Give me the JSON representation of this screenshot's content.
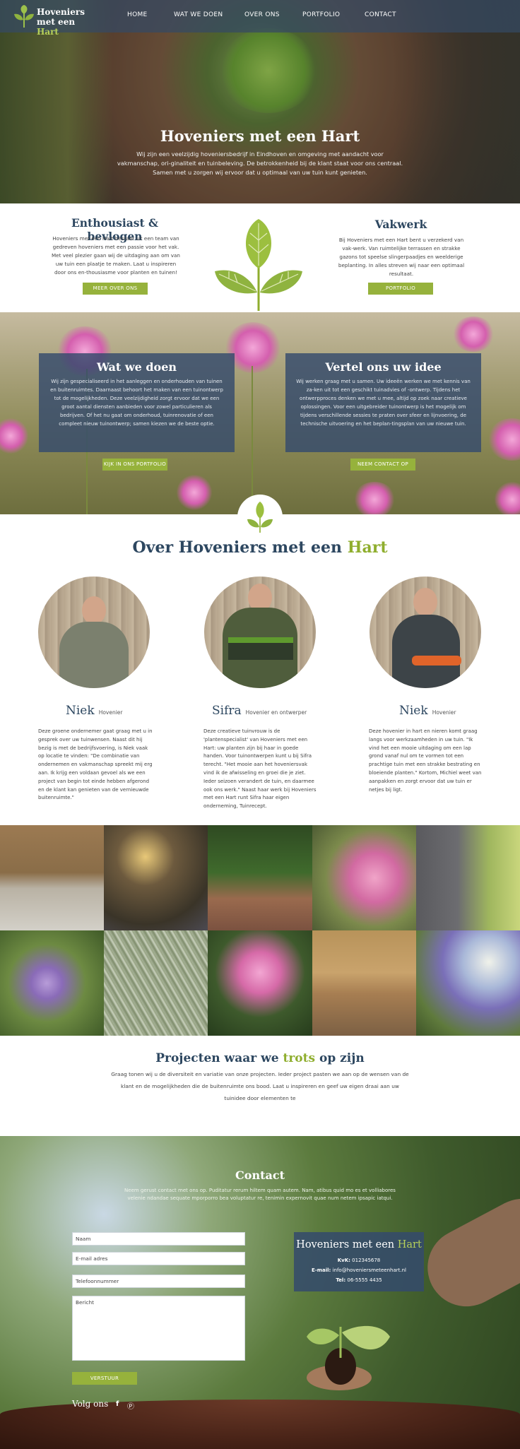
{
  "brand": {
    "line1": "Hoveniers",
    "line2a": "met een",
    "line2b": "Hart"
  },
  "nav": [
    "HOME",
    "WAT WE DOEN",
    "OVER ONS",
    "PORTFOLIO",
    "CONTACT"
  ],
  "hero": {
    "title": "Hoveniers met een Hart",
    "subtitle": "Wij zijn een veelzijdig hoveniersbedrijf in Eindhoven en omgeving met aandacht voor vakmanschap, ori-ginaliteit en tuinbeleving. De betrokkenheid bij de klant staat voor ons centraal. Samen met u zorgen wij ervoor dat u optimaal van uw tuin kunt genieten."
  },
  "intro": {
    "left": {
      "title": "Enthousiast & bevlogen",
      "text": "Hoveniers met een Hart bestaat uit een team van gedreven hoveniers met een passie voor het vak. Met veel plezier gaan wij de uitdaging aan om van uw tuin een plaatje te maken. Laat u inspireren door ons en-thousiasme voor planten en tuinen!",
      "button": "MEER OVER ONS"
    },
    "right": {
      "title": "Vakwerk",
      "text": "Bij Hoveniers met een Hart bent u verzekerd van vak-werk. Van ruimtelijke terrassen en strakke gazons tot speelse slingerpaadjes en weelderige beplanting. In alles streven wij naar een optimaal resultaat.",
      "button": "PORTFOLIO"
    }
  },
  "services": {
    "left": {
      "title": "Wat we doen",
      "text": "Wij zijn gespecialiseerd in het aanleggen en onderhouden van tuinen en buitenruimtes. Daarnaast behoort het maken van een tuinontwerp tot de mogelijkheden. Deze veelzijdigheid zorgt ervoor dat we een groot aantal diensten aanbieden voor zowel particulieren als bedrijven. Of het nu gaat om onderhoud, tuinrenovatie of een compleet nieuw tuinontwerp; samen kiezen we de beste optie.",
      "button": "KIJK IN ONS PORTFOLIO"
    },
    "right": {
      "title": "Vertel ons uw idee",
      "text": "Wij werken graag met u samen. Uw ideeën werken we met kennis van za-ken uit tot een geschikt tuinadvies of -ontwerp. Tijdens het ontwerpproces denken we met u mee, altijd op zoek naar creatieve oplossingen. Voor een uitgebreider tuinontwerp is het mogelijk om tijdens verschillende sessies te praten over sfeer en lijnvoering, de technische uitvoering en het beplan-tingsplan van uw nieuwe tuin.",
      "button": "NEEM CONTACT OP"
    }
  },
  "about": {
    "title_main": "Over Hoveniers met een",
    "title_accent": "Hart",
    "team": [
      {
        "name": "Niek",
        "role": "Hovenier",
        "text": "Deze groene ondernemer gaat graag met u in gesprek over uw tuinwensen. Naast dit hij bezig is met de bedrijfsvoering, is Niek vaak op locatie te vinden: \"De combinatie van ondernemen en vakmanschap spreekt mij erg aan. Ik krijg een voldaan gevoel als we een project van begin tot einde hebben afgerond en de klant kan genieten van de vernieuwde buitenruimte.\""
      },
      {
        "name": "Sifra",
        "role": "Hovenier en ontwerper",
        "text": "Deze creatieve tuinvrouw is de 'plantenspecialist' van Hoveniers met een Hart: uw planten zijn bij haar in goede handen. Voor tuinontwerpen kunt u bij Sifra terecht. \"Het mooie aan het hoveniersvak vind ik de afwisseling en groei die je ziet. Ieder seizoen verandert de tuin, en daarmee ook ons werk.\" Naast haar werk bij Hoveniers met een Hart runt Sifra haar eigen onderneming, Tuinrecept."
      },
      {
        "name": "Niek",
        "role": "Hovenier",
        "text": "Deze hovenier in hart en nieren komt graag langs voor werkzaamheden in uw tuin. \"Ik vind het een mooie uitdaging om een lap grond vanaf nul om te vormen tot een prachtige tuin met een strakke bestrating en bloeiende planten.\" Kortom, Michiel weet van aanpakken en zorgt ervoor dat uw tuin er netjes bij ligt."
      }
    ]
  },
  "projects": {
    "title_a": "Projecten waar we",
    "title_accent": "trots",
    "title_b": "op zijn",
    "text": "Graag tonen wij u de diversiteit en variatie van onze projecten. Ieder project pasten we aan op de wensen van de klant en de mogelijkheden die de buitenruimte ons bood. Laat u inspireren en geef uw eigen draai aan uw tuinidee door elementen te"
  },
  "contact": {
    "title": "Contact",
    "subtitle": "Neem gerust contact met ons op. Puditatur rerum hiltem quam autem. Nam, atibus quid mo es et volliabores velenie ndandae sequate mporporro bea voluptatur re, tenimin expernovit quae num netem ipsapic iatqui.",
    "fields": {
      "name": "Naam",
      "email": "E-mail adres",
      "phone": "Telefoonnummer",
      "message": "Bericht"
    },
    "send": "VERSTUUR",
    "card": {
      "title_a": "Hoveniers met een",
      "title_b": "Hart",
      "kvk_label": "KvK:",
      "kvk": "012345678",
      "email_label": "E-mail:",
      "email": "info@hoveniersmeteenhart.nl",
      "tel_label": "Tel:",
      "tel": "06-5555 4435"
    },
    "follow": "Volg ons",
    "social": [
      "facebook-icon",
      "pinterest-icon"
    ]
  },
  "colors": {
    "navy": "#2d4760",
    "green": "#96b23c",
    "accent": "#8fae2e"
  }
}
